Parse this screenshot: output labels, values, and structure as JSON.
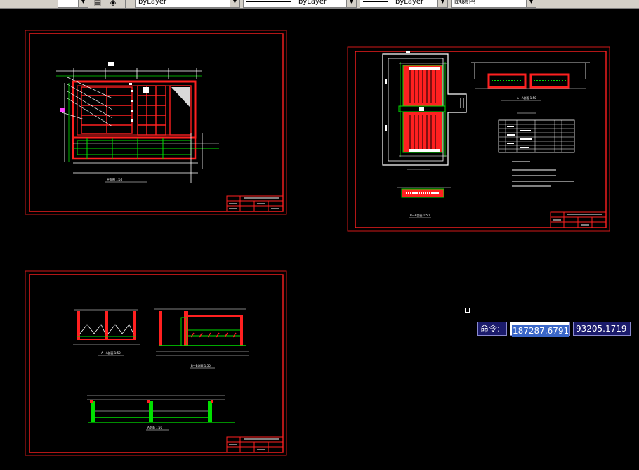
{
  "toolbar": {
    "layer_combo_value": "byLayer",
    "linetype_combo_value": "byLayer",
    "lineweight_combo_value": "byLayer",
    "color_combo_value": "随颜色"
  },
  "command_input": {
    "prompt_label": "命令:",
    "x_value": "187287.6791",
    "y_value": "93205.1719"
  },
  "sheet_titles": {
    "sheet1_plan_caption": "平面图 1:50",
    "sheet2_a_a_caption": "A—A剖面 1:50",
    "sheet2_b_b_caption": "B—B剖面 1:50",
    "sheet3_a_a_caption": "A—A剖面 1:50",
    "sheet3_b_b_caption": "B—B剖面 1:50",
    "sheet3_c_caption": "A剖面 1:50"
  },
  "colors": {
    "background": "#000000",
    "frame": "#ff2020",
    "green": "#00e000",
    "white": "#ffffff",
    "yellow": "#ffff00"
  }
}
